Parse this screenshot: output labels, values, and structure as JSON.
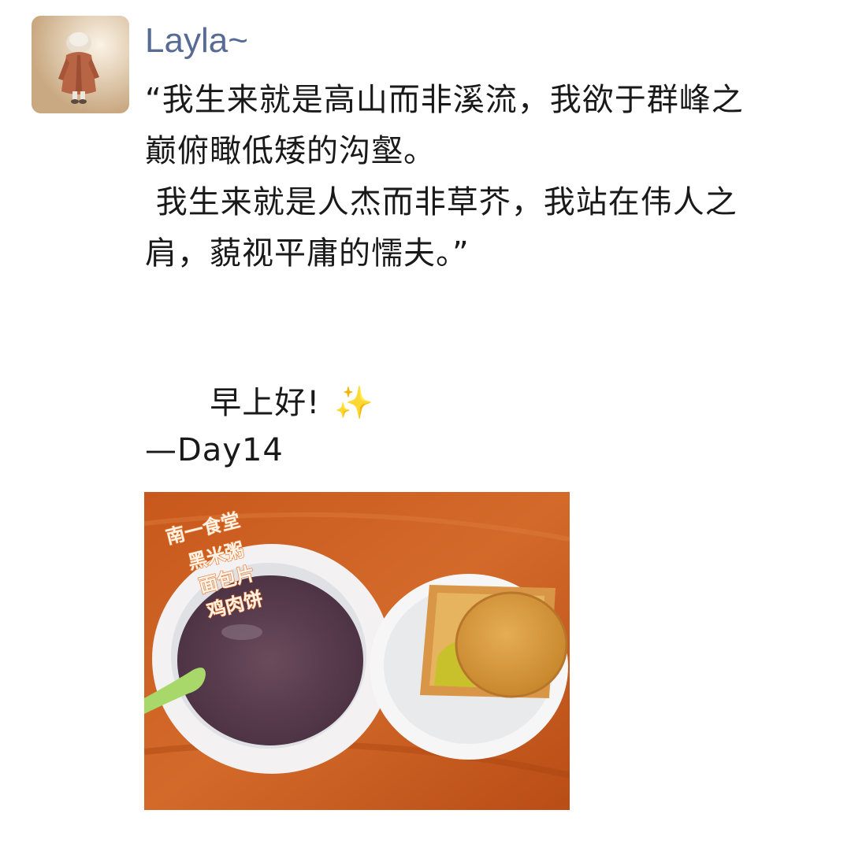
{
  "post": {
    "username": "Layla~",
    "lines": [
      "“我生来就是高山而非溪流，我欲于群峰之",
      "巅俯瞰低矮的沟壑。",
      " 我生来就是人杰而非草芥，我站在伟人之",
      "肩，藐视平庸的懦夫。”"
    ],
    "greeting": "早上好!",
    "greeting_emoji": "✨",
    "signature": "—Day14"
  },
  "photo": {
    "tags": [
      "南一食堂",
      "黑米粥",
      "面包片",
      "鸡肉饼"
    ]
  },
  "colors": {
    "username": "#576b95",
    "text": "#191919",
    "background": "#ffffff"
  },
  "icons": {
    "avatar": "avatar-illustration",
    "sparkles": "sparkles-emoji"
  }
}
